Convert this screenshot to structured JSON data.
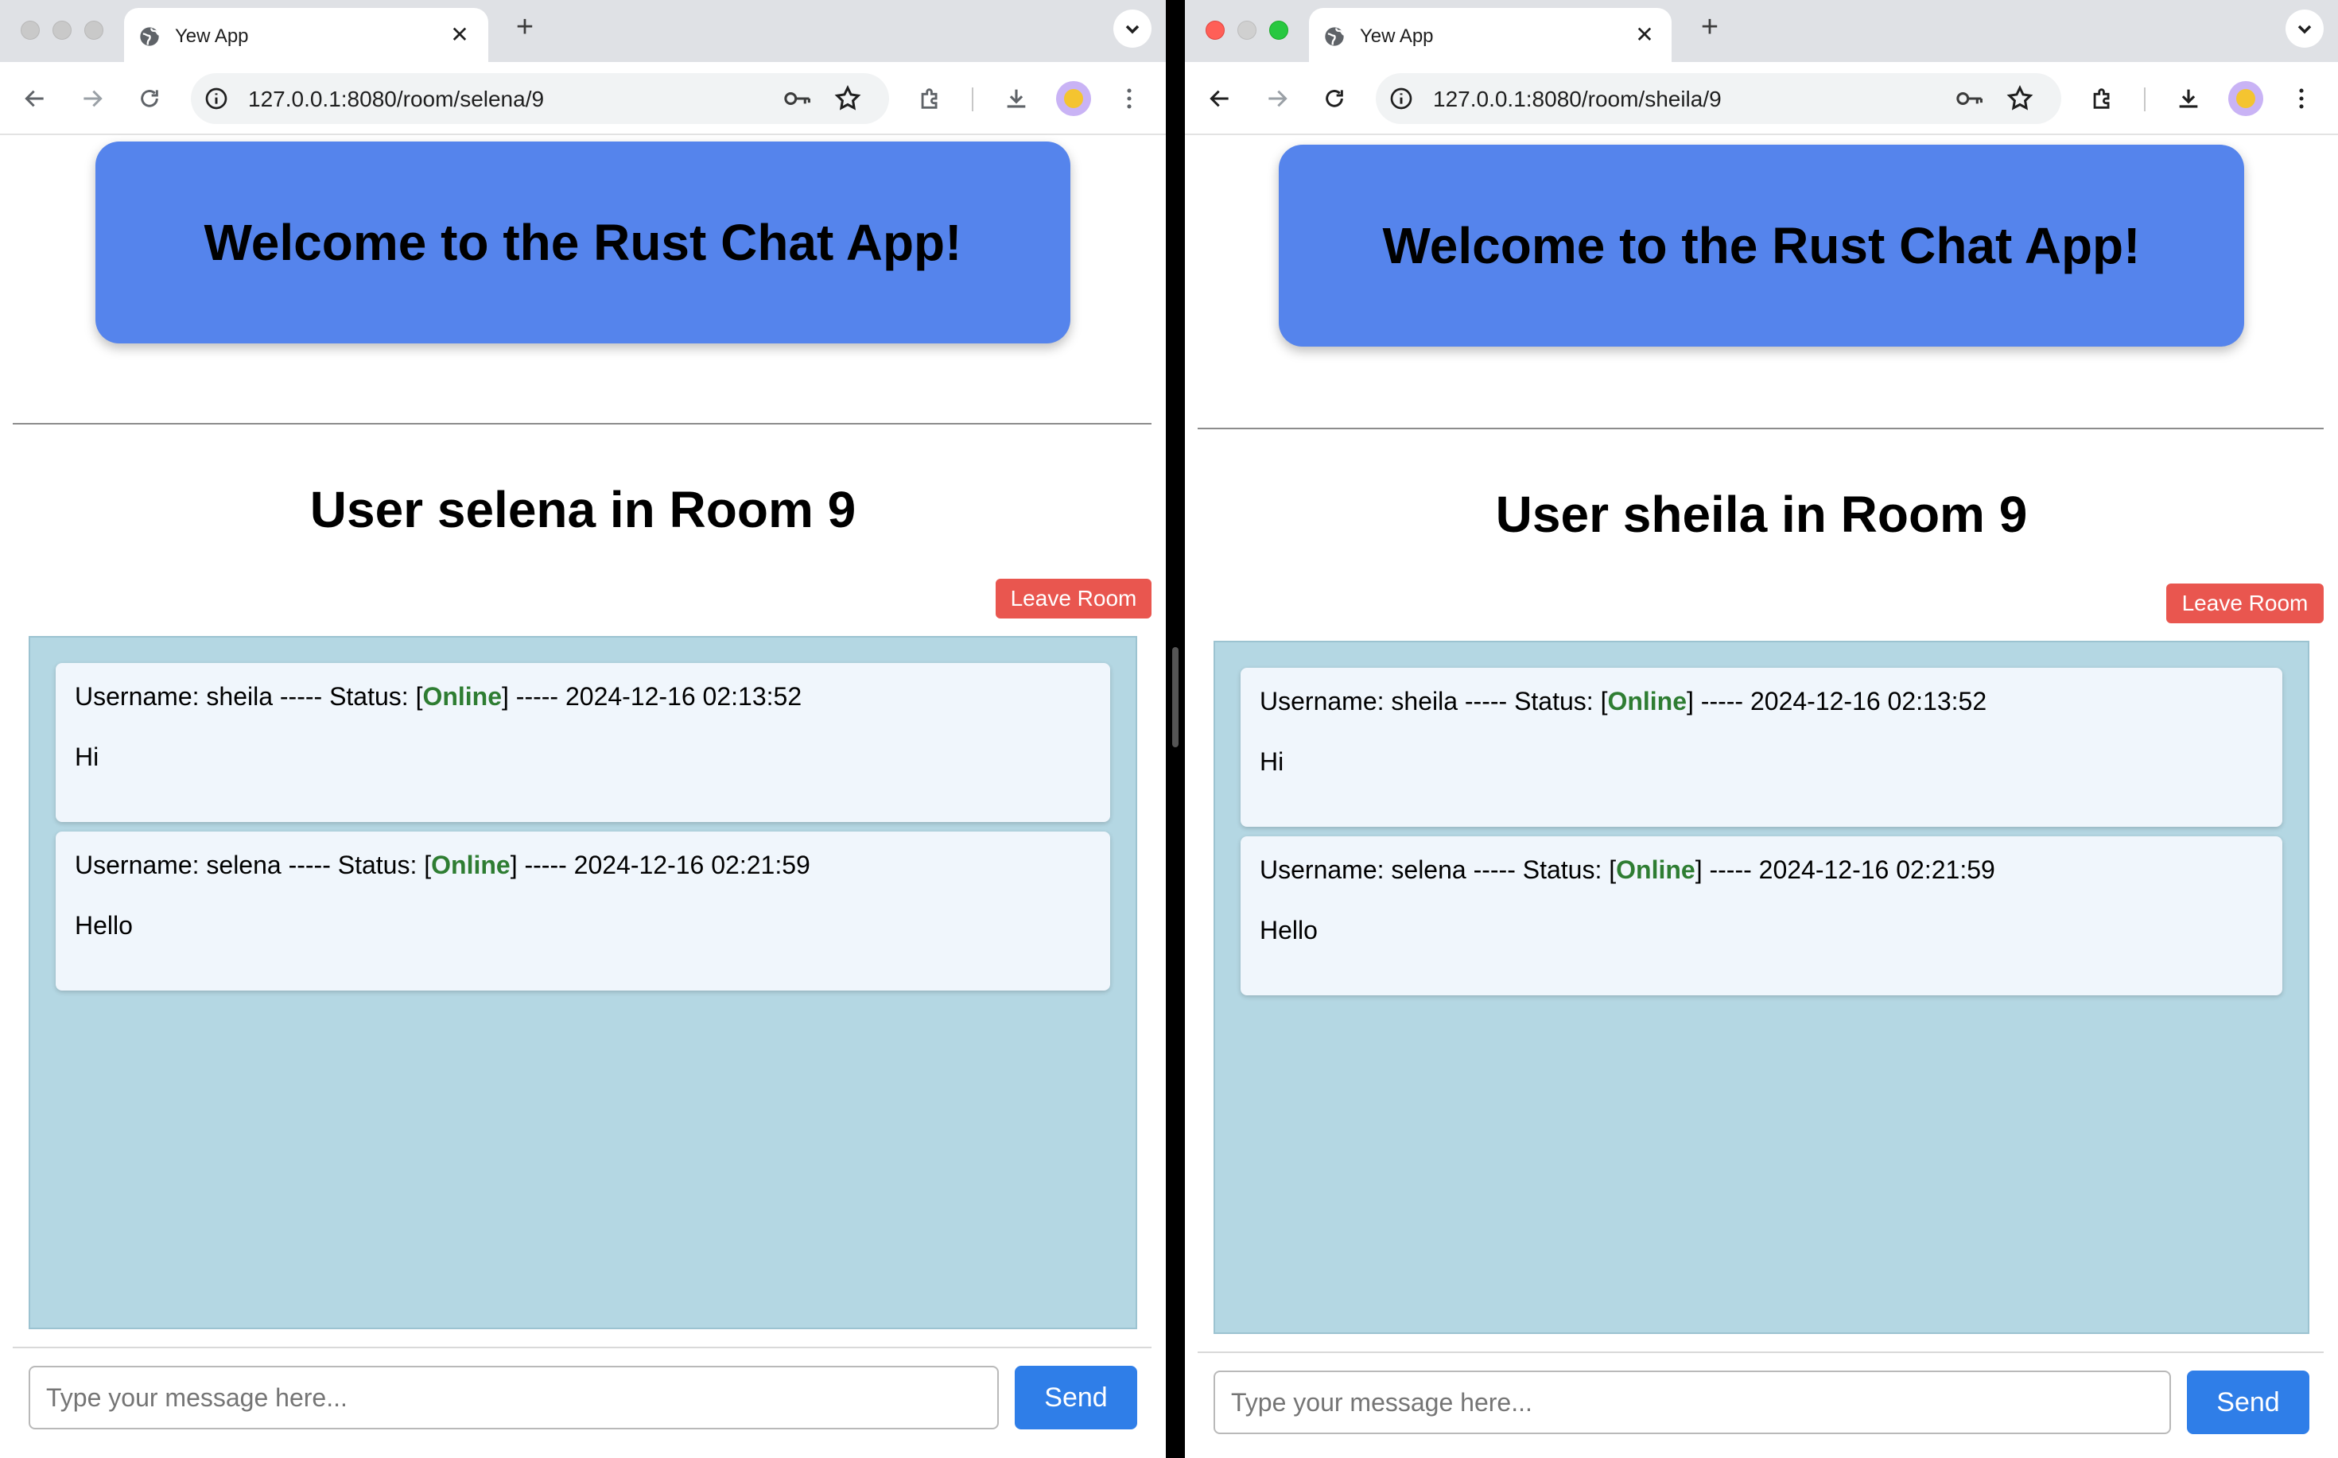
{
  "browser_left": {
    "tab_title": "Yew App",
    "tab_close_glyph": "✕",
    "new_tab_glyph": "+",
    "url": "127.0.0.1:8080/room/selena/9"
  },
  "browser_right": {
    "tab_title": "Yew App",
    "tab_close_glyph": "✕",
    "new_tab_glyph": "+",
    "url": "127.0.0.1:8080/room/sheila/9"
  },
  "app_left": {
    "banner": "Welcome to the Rust Chat App!",
    "room_title": "User selena in Room 9",
    "leave_label": "Leave Room",
    "messages": [
      {
        "prefix": "Username: sheila ----- Status: [",
        "status": "Online",
        "suffix": "] ----- 2024-12-16 02:13:52",
        "text": "Hi"
      },
      {
        "prefix": "Username: selena ----- Status: [",
        "status": "Online",
        "suffix": "] ----- 2024-12-16 02:21:59",
        "text": "Hello"
      }
    ],
    "input_placeholder": "Type your message here...",
    "send_label": "Send"
  },
  "app_right": {
    "banner": "Welcome to the Rust Chat App!",
    "room_title": "User sheila in Room 9",
    "leave_label": "Leave Room",
    "messages": [
      {
        "prefix": "Username: sheila ----- Status: [",
        "status": "Online",
        "suffix": "] ----- 2024-12-16 02:13:52",
        "text": "Hi"
      },
      {
        "prefix": "Username: selena ----- Status: [",
        "status": "Online",
        "suffix": "] ----- 2024-12-16 02:21:59",
        "text": "Hello"
      }
    ],
    "input_placeholder": "Type your message here...",
    "send_label": "Send"
  },
  "colors": {
    "banner": "#5584ec",
    "leave_button": "#e9564f",
    "send_button": "#2f7ee8",
    "message_area": "#b4d7e3",
    "status_online": "#2e7d32"
  },
  "icons": [
    "globe-icon",
    "close-icon",
    "plus-icon",
    "chevron-down-icon",
    "back-arrow-icon",
    "forward-arrow-icon",
    "reload-icon",
    "info-icon",
    "key-icon",
    "star-icon",
    "extensions-icon",
    "download-icon",
    "profile-avatar",
    "more-vert-icon"
  ]
}
